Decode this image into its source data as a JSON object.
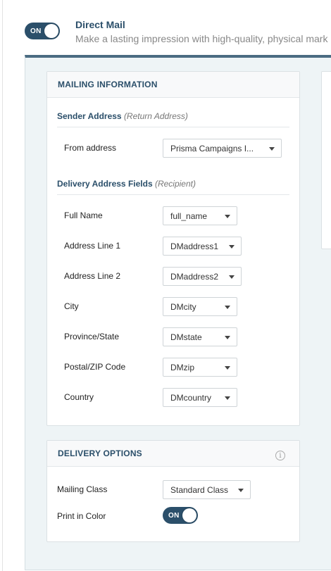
{
  "header": {
    "toggle_label": "ON",
    "title": "Direct Mail",
    "subtitle": "Make a lasting impression with high-quality, physical mark"
  },
  "mailing": {
    "heading": "MAILING INFORMATION",
    "sender_section": {
      "label": "Sender Address",
      "note": "(Return Address)"
    },
    "from_address": {
      "label": "From address",
      "value": "Prisma Campaigns I..."
    },
    "delivery_section": {
      "label": "Delivery Address Fields",
      "note": "(Recipient)"
    },
    "fields": [
      {
        "label": "Full Name",
        "value": "full_name"
      },
      {
        "label": "Address Line 1",
        "value": "DMaddress1"
      },
      {
        "label": "Address Line 2",
        "value": "DMaddress2"
      },
      {
        "label": "City",
        "value": "DMcity"
      },
      {
        "label": "Province/State",
        "value": "DMstate"
      },
      {
        "label": "Postal/ZIP Code",
        "value": "DMzip"
      },
      {
        "label": "Country",
        "value": "DMcountry"
      }
    ]
  },
  "delivery": {
    "heading": "DELIVERY OPTIONS",
    "info_icon": "info-icon",
    "mailing_class": {
      "label": "Mailing Class",
      "value": "Standard Class"
    },
    "print_color": {
      "label": "Print in Color",
      "toggle_label": "ON"
    }
  },
  "colors": {
    "accent": "#2b4f6a",
    "panel_bg": "#eef4f6"
  }
}
